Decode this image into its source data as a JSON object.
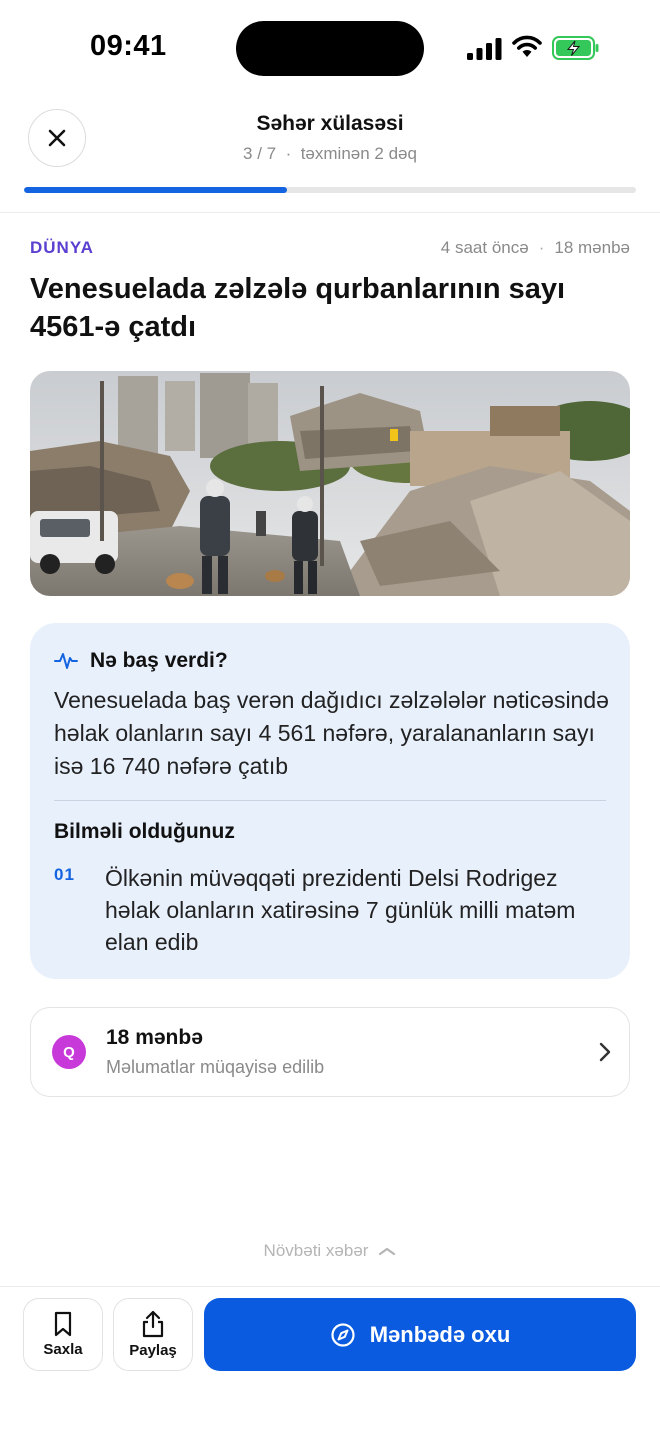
{
  "status_bar": {
    "time": "09:41"
  },
  "header": {
    "title": "Səhər xülasəsi",
    "position": "3 / 7",
    "separator": "·",
    "duration": "təxminən 2 dəq",
    "progress_fraction": 0.43
  },
  "article": {
    "category": "DÜNYA",
    "time_ago": "4 saat öncə",
    "meta_separator": "·",
    "sources_count": "18 mənbə",
    "headline": "Venesuelada zəlzələ qurbanlarının sayı 4561-ə çatdı"
  },
  "summary": {
    "heading": "Nə baş verdi?",
    "body": "Venesuelada baş verən dağıdıcı zəlzələlər nəticəsində həlak olanların sayı 4 561 nəfərə, yaralananların sayı isə 16 740 nəfərə çatıb",
    "know_heading": "Bilməli olduğunuz",
    "items": [
      {
        "num": "01",
        "text": "Ölkənin müvəqqəti prezidenti Delsi Rodrigez həlak olanların xatirəsinə 7 günlük milli matəm elan edib"
      }
    ]
  },
  "sources": {
    "badge": "Q",
    "title": "18 mənbə",
    "subtitle": "Məlumatlar müqayisə edilib"
  },
  "next_story": {
    "label": "Növbəti xəbər"
  },
  "toolbar": {
    "save_label": "Saxla",
    "share_label": "Paylaş",
    "read_label": "Mənbədə oxu"
  },
  "colors": {
    "accent": "#1463e0",
    "category": "#5b3fd0",
    "summary_bg": "#e8f0fc",
    "badge": "#c73ad9"
  }
}
